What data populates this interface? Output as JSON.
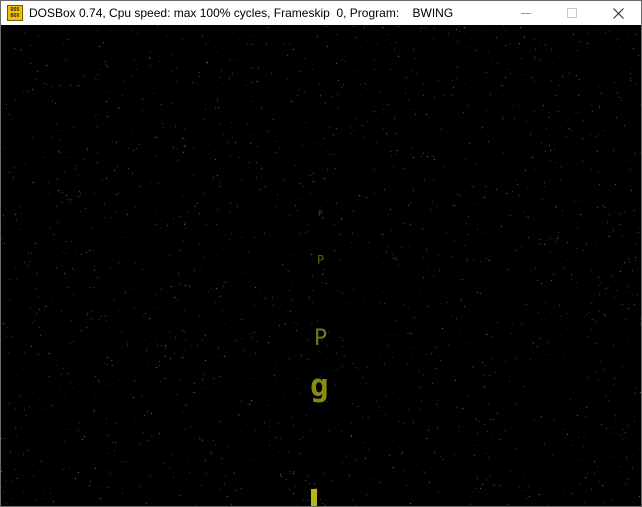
{
  "window": {
    "title": "DOSBox 0.74, Cpu speed: max 100% cycles, Frameskip  0, Program:    BWING",
    "icon": {
      "name": "dosbox-icon",
      "line1": "DOS",
      "line2": "BOX",
      "color": "#f2c200"
    },
    "controls": {
      "minimize": "minimize-icon",
      "maximize": "maximize-icon",
      "close": "close-icon"
    }
  },
  "game": {
    "background_color": "#000000",
    "characters": [
      {
        "text": "P"
      },
      {
        "text": "P"
      },
      {
        "text": "P"
      },
      {
        "text": "g"
      }
    ],
    "ship_color": "#b7b711"
  }
}
